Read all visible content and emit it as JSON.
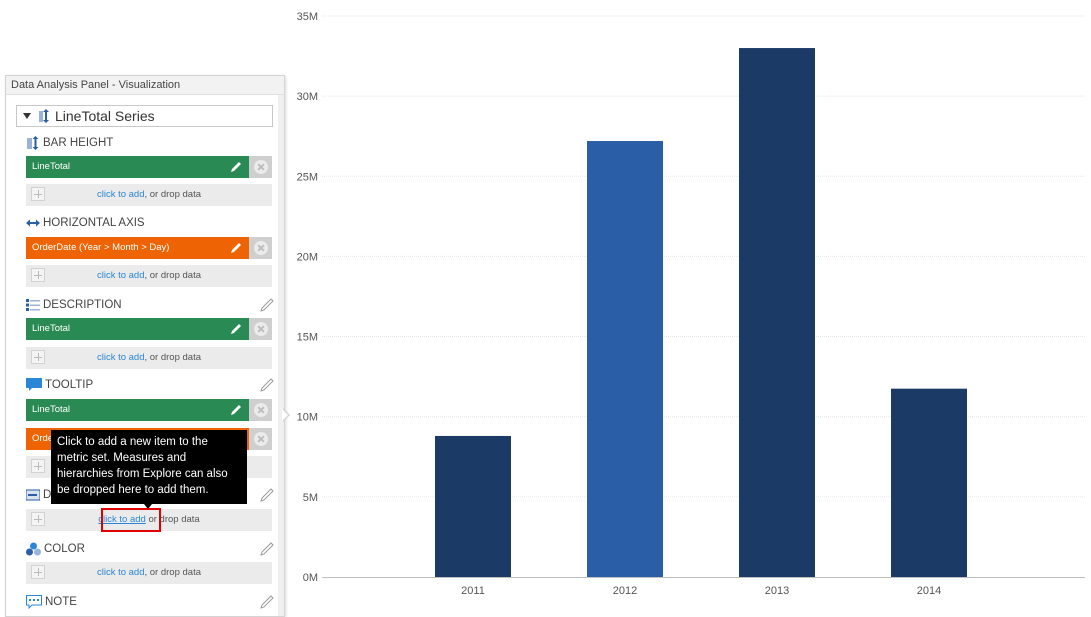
{
  "panel": {
    "title": "Data Analysis Panel - Visualization",
    "series_label": "LineTotal Series",
    "sections": [
      {
        "label": "BAR HEIGHT",
        "icon": "bar-height-icon"
      },
      {
        "label": "HORIZONTAL AXIS",
        "icon": "horizontal-axis-icon"
      },
      {
        "label": "DESCRIPTION",
        "icon": "description-icon"
      },
      {
        "label": "TOOLTIP",
        "icon": "tooltip-icon"
      },
      {
        "label": "D",
        "icon": "data-label-icon"
      },
      {
        "label": "COLOR",
        "icon": "color-icon"
      },
      {
        "label": "NOTE",
        "icon": "note-icon"
      }
    ],
    "pills": {
      "bar_height": "LineTotal",
      "horizontal_axis": "OrderDate (Year > Month > Day)",
      "description": "LineTotal",
      "tooltip_1": "LineTotal",
      "tooltip_2": "Orde"
    },
    "add_link": "click to add",
    "add_rest": ", or drop data",
    "add_rest_partial": "or drop data"
  },
  "tooltip": {
    "text": "Click to add a new item to the metric set. Measures and hierarchies from Explore can also be dropped here to add them."
  },
  "colors": {
    "green": "#2a8a53",
    "orange": "#ee6404",
    "bar_dark": "#1c3a66",
    "bar_highlight": "#2a5ea6",
    "link": "#2b86d6",
    "highlight": "#e00000"
  },
  "chart_data": {
    "type": "bar",
    "categories": [
      "2011",
      "2012",
      "2013",
      "2014"
    ],
    "values": [
      8800000,
      27200000,
      33000000,
      11750000
    ],
    "ylim": [
      0,
      35000000
    ],
    "yticks": [
      0,
      5000000,
      10000000,
      15000000,
      20000000,
      25000000,
      30000000,
      35000000
    ],
    "ytick_labels": [
      "0M",
      "5M",
      "10M",
      "15M",
      "20M",
      "25M",
      "30M",
      "35M"
    ],
    "highlighted_category": "2012",
    "grid": true
  }
}
